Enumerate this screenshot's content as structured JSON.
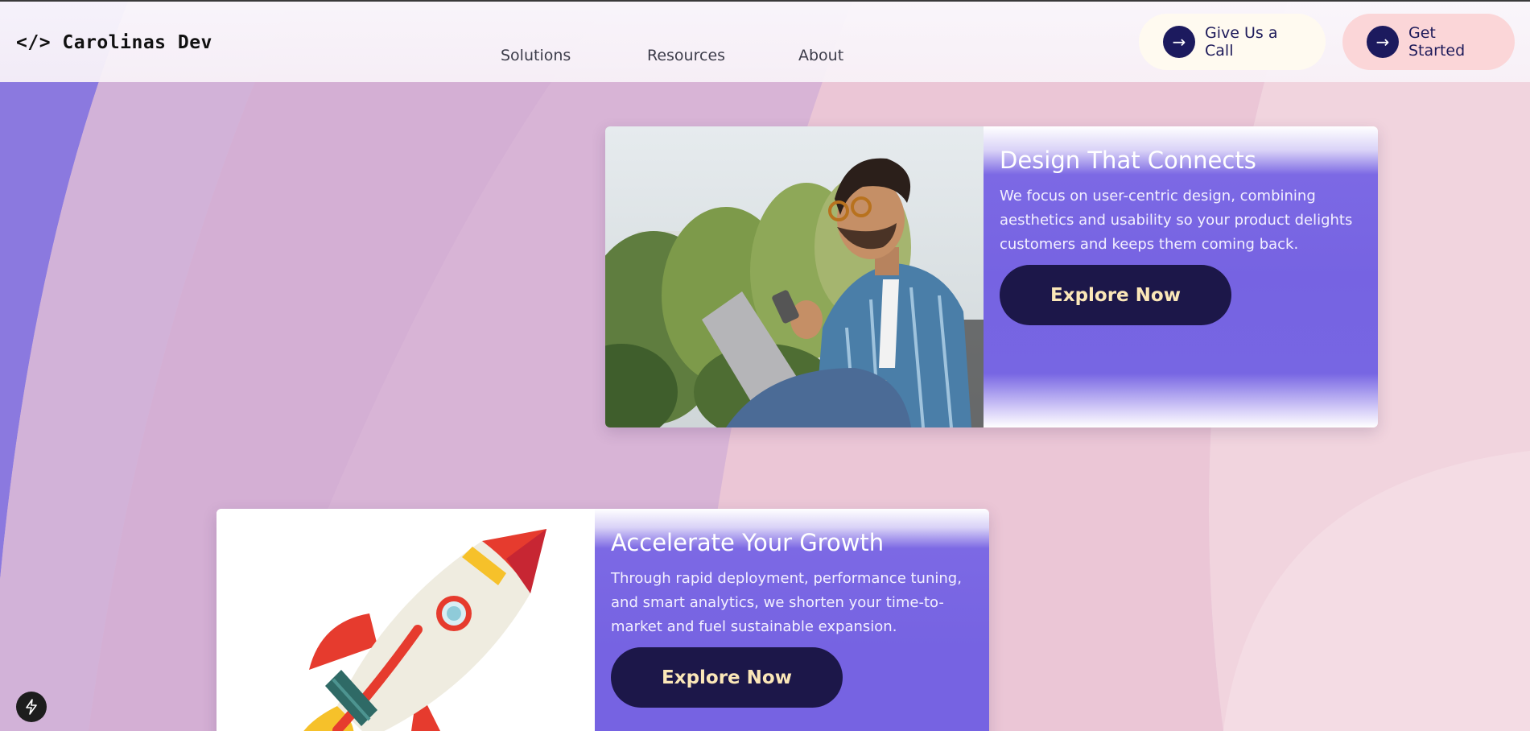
{
  "header": {
    "logo": "</> Carolinas Dev",
    "nav": {
      "solutions": "Solutions",
      "resources": "Resources",
      "about": "About"
    },
    "cta_call": {
      "label": "Give Us a Call",
      "icon": "arrow-right-icon"
    },
    "cta_start": {
      "label": "Get Started",
      "icon": "arrow-right-icon"
    }
  },
  "cards": [
    {
      "image": "person-with-laptop-and-phone-photo",
      "title": "Design That Connects",
      "text": "We focus on user-centric design, combining aesthetics and usability so your product delights customers and keeps them coming back.",
      "button": "Explore Now"
    },
    {
      "image": "rocket-illustration",
      "title": "Accelerate Your Growth",
      "text": "Through rapid deployment, performance tuning, and smart analytics, we shorten your time-to-market and fuel sustainable expansion.",
      "button": "Explore Now"
    }
  ],
  "badge": {
    "icon": "lightning-bolt-icon"
  },
  "colors": {
    "accent_purple": "#7663e2",
    "button_navy": "#1c1749",
    "button_text": "#fbe7b8",
    "cta_start_bg": "#fbd6d8",
    "cta_call_bg": "#fffaf0"
  }
}
